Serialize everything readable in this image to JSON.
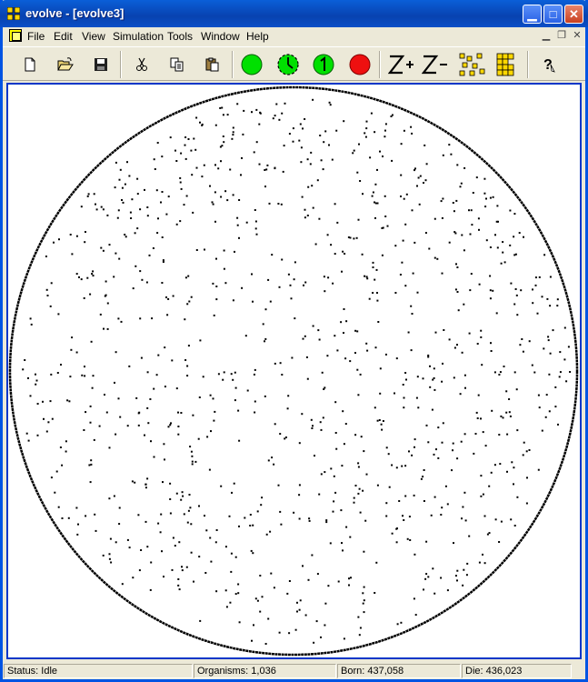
{
  "window": {
    "title": "evolve - [evolve3]"
  },
  "menu": {
    "items": [
      "File",
      "Edit",
      "View",
      "Simulation",
      "Tools",
      "Window",
      "Help"
    ]
  },
  "status": {
    "state": "Status: Idle",
    "organisms": "Organisms: 1,036",
    "born": "Born: 437,058",
    "die": "Die: 436,023"
  },
  "colors": {
    "title_blue": "#0a4fc7",
    "simulation_go": "#00e000",
    "simulation_stop": "#ee1010",
    "canvas_border": "#0036c8"
  },
  "icons": [
    "new-icon",
    "open-icon",
    "save-icon",
    "cut-icon",
    "copy-icon",
    "paste-icon",
    "continue-simulation-icon",
    "timed-step-icon",
    "single-step-icon",
    "stop-simulation-icon",
    "zoom-in-icon",
    "zoom-out-icon",
    "scatter-view-icon",
    "grid-view-icon",
    "help-icon"
  ]
}
